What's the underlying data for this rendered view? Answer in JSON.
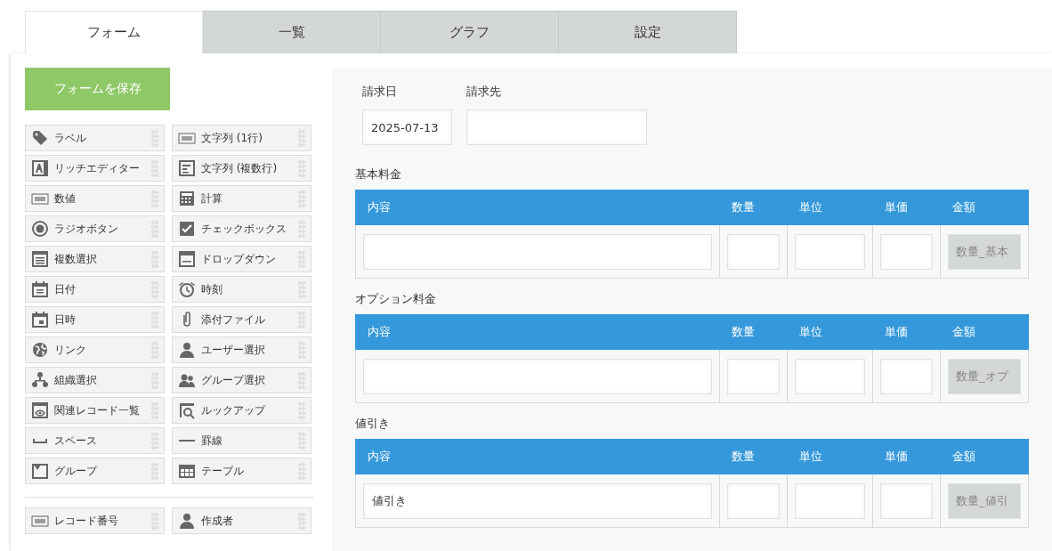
{
  "tabs": [
    {
      "label": "フォーム",
      "selected": true
    },
    {
      "label": "一覧",
      "selected": false
    },
    {
      "label": "グラフ",
      "selected": false
    },
    {
      "label": "設定",
      "selected": false
    }
  ],
  "save_button": "フォームを保存",
  "palette": {
    "items": [
      {
        "kind": "label",
        "label": "ラベル"
      },
      {
        "kind": "single_line_text",
        "label": "文字列 (1行)"
      },
      {
        "kind": "rich_text",
        "label": "リッチエディター"
      },
      {
        "kind": "multi_line_text",
        "label": "文字列 (複数行)"
      },
      {
        "kind": "number",
        "label": "数値"
      },
      {
        "kind": "calc",
        "label": "計算"
      },
      {
        "kind": "radio",
        "label": "ラジオボタン"
      },
      {
        "kind": "checkbox",
        "label": "チェックボックス"
      },
      {
        "kind": "multi_select",
        "label": "複数選択"
      },
      {
        "kind": "dropdown",
        "label": "ドロップダウン"
      },
      {
        "kind": "date",
        "label": "日付"
      },
      {
        "kind": "time",
        "label": "時刻"
      },
      {
        "kind": "datetime",
        "label": "日時"
      },
      {
        "kind": "file",
        "label": "添付ファイル"
      },
      {
        "kind": "link",
        "label": "リンク"
      },
      {
        "kind": "user",
        "label": "ユーザー選択"
      },
      {
        "kind": "org",
        "label": "組織選択"
      },
      {
        "kind": "group_select",
        "label": "グループ選択"
      },
      {
        "kind": "related",
        "label": "関連レコード一覧"
      },
      {
        "kind": "lookup",
        "label": "ルックアップ"
      },
      {
        "kind": "space",
        "label": "スペース"
      },
      {
        "kind": "rule",
        "label": "罫線"
      },
      {
        "kind": "group",
        "label": "グループ"
      },
      {
        "kind": "table",
        "label": "テーブル"
      }
    ],
    "system_items": [
      {
        "kind": "number",
        "label": "レコード番号"
      },
      {
        "kind": "user",
        "label": "作成者"
      }
    ]
  },
  "form": {
    "fields": [
      {
        "label": "請求日",
        "value": "2025-07-13"
      },
      {
        "label": "請求先"
      }
    ],
    "tables": [
      {
        "title": "基本料金",
        "columns": [
          "内容",
          "数量",
          "単位",
          "単価",
          "金額"
        ],
        "cells": [
          {
            "kind": "input"
          },
          {
            "kind": "input"
          },
          {
            "kind": "input"
          },
          {
            "kind": "input"
          },
          {
            "kind": "calc",
            "value": "数量_基本"
          }
        ]
      },
      {
        "title": "オプション料金",
        "columns": [
          "内容",
          "数量",
          "単位",
          "単価",
          "金額"
        ],
        "cells": [
          {
            "kind": "input"
          },
          {
            "kind": "input"
          },
          {
            "kind": "input"
          },
          {
            "kind": "input"
          },
          {
            "kind": "calc",
            "value": "数量_オプ"
          }
        ]
      },
      {
        "title": "値引き",
        "columns": [
          "内容",
          "数量",
          "単位",
          "単価",
          "金額"
        ],
        "cells": [
          {
            "kind": "input",
            "value": "値引き"
          },
          {
            "kind": "input"
          },
          {
            "kind": "input"
          },
          {
            "kind": "input"
          },
          {
            "kind": "calc",
            "value": "数量_値引"
          }
        ]
      }
    ]
  }
}
